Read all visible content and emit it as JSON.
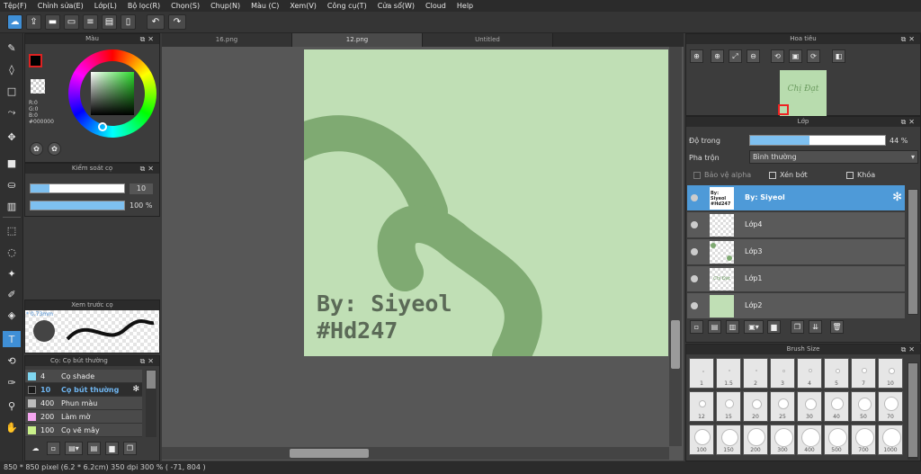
{
  "menu": [
    "Tệp(F)",
    "Chỉnh sửa(E)",
    "Lớp(L)",
    "Bộ lọc(R)",
    "Chọn(S)",
    "Chụp(N)",
    "Màu (C)",
    "Xem(V)",
    "Công cụ(T)",
    "Cửa sổ(W)",
    "Cloud",
    "Help"
  ],
  "tabs": [
    "16.png",
    "12.png",
    "Untitled"
  ],
  "color_panel": {
    "title": "Màu",
    "r": "R:0",
    "g": "G:0",
    "b": "B:0",
    "hex": "#000000"
  },
  "brush_control": {
    "title": "Kiểm soát cọ",
    "size": "10",
    "opacity": "100 %",
    "opacity_pct": 100,
    "size_fraction": 0.2
  },
  "preview": {
    "title": "Xem trước cọ",
    "size_label": "* 0.73mm"
  },
  "brush_list": {
    "title": "Cọ: Cọ bút thường",
    "items": [
      {
        "size": "4",
        "name": "Cọ shade",
        "color": "#7fd6f0"
      },
      {
        "size": "10",
        "name": "Cọ bút thường",
        "color": "#1a1a1a"
      },
      {
        "size": "400",
        "name": "Phun màu",
        "color": "#bbbbbb"
      },
      {
        "size": "200",
        "name": "Làm mờ",
        "color": "#f5a6f0"
      },
      {
        "size": "100",
        "name": "Cọ vẽ mây",
        "color": "#c9f08a"
      }
    ]
  },
  "document": {
    "line1": "By: Siyeol",
    "line2": "#Hd247",
    "bg": "#c0dfb5",
    "stroke": "#7faa72"
  },
  "navigator": {
    "title": "Hoa tiêu",
    "thumb_text": "Chị Đạt"
  },
  "layers": {
    "title": "Lớp",
    "opacity_label": "Độ trong",
    "opacity_value": "44 %",
    "opacity_fraction": 0.44,
    "blend_label": "Pha trộn",
    "blend_value": "Bình thường",
    "protect_alpha": "Bảo vệ alpha",
    "clipping": "Xén bớt",
    "lock": "Khóa",
    "items": [
      {
        "name": "By: Siyeol",
        "thumb_text": "By: Siyeol #Hd247"
      },
      {
        "name": "Lớp4",
        "thumb_text": ""
      },
      {
        "name": "Lớp3",
        "thumb_text": ""
      },
      {
        "name": "Lớp1",
        "thumb_text": "Chị Đạt"
      },
      {
        "name": "Lớp2",
        "thumb_text": ""
      }
    ]
  },
  "brush_size": {
    "title": "Brush Size",
    "sizes": [
      "1",
      "1.5",
      "2",
      "3",
      "4",
      "5",
      "7",
      "10",
      "12",
      "15",
      "20",
      "25",
      "30",
      "40",
      "50",
      "70",
      "100",
      "150",
      "200",
      "300",
      "400",
      "500",
      "700",
      "1000"
    ]
  },
  "status": "850 * 850 pixel   (6.2 * 6.2cm)   350 dpi   300 %   ( -71, 804 )",
  "colors": {
    "accent": "#3f8fd6",
    "selected_layer": "#4e9ad8"
  }
}
